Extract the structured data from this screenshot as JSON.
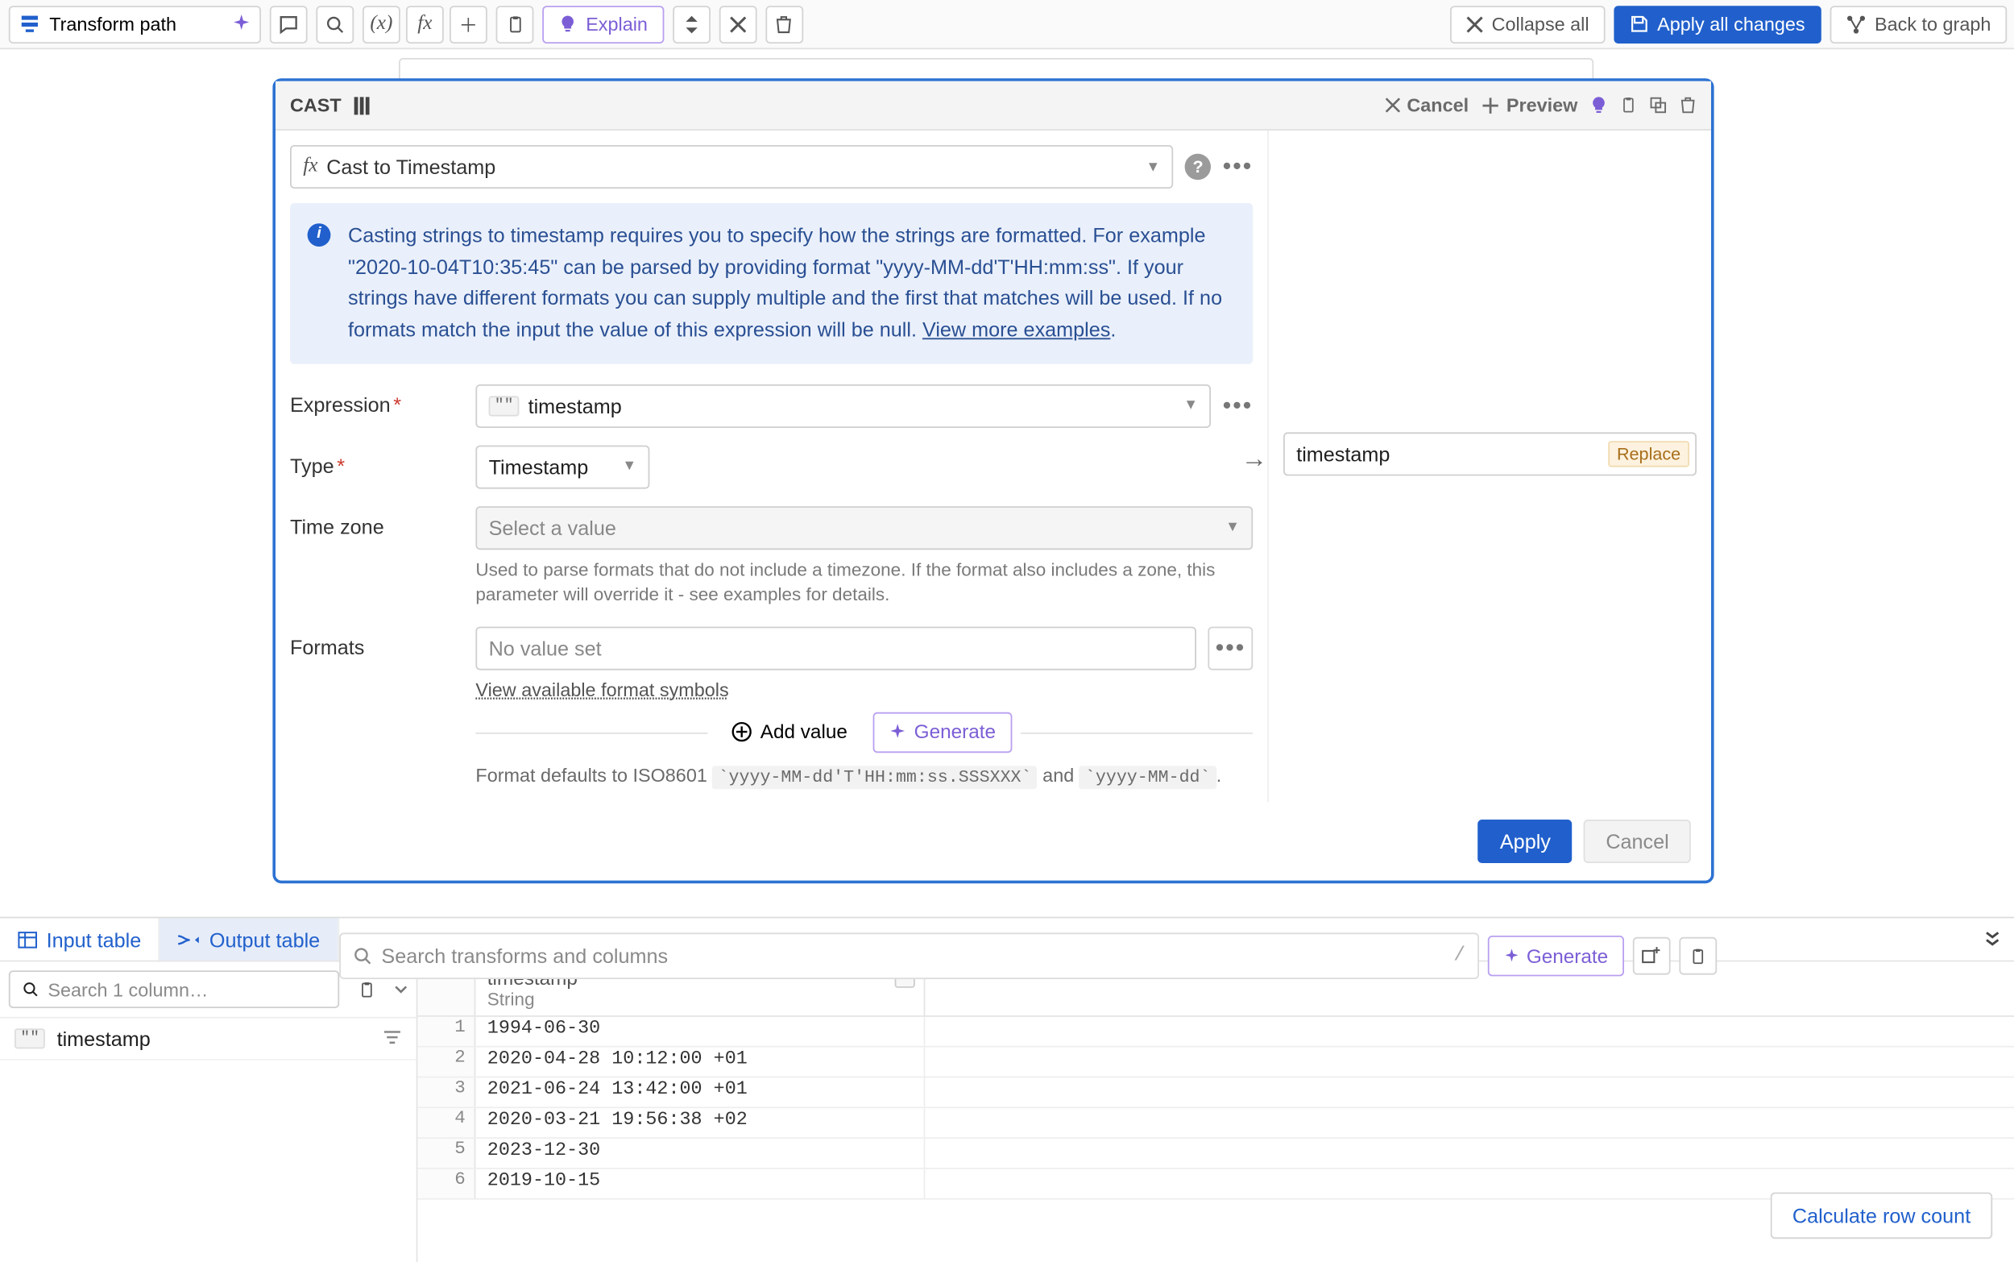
{
  "toolbar": {
    "transform_path": "Transform path",
    "explain": "Explain",
    "collapse_all": "Collapse all",
    "apply_all": "Apply all changes",
    "back_to_graph": "Back to graph"
  },
  "card": {
    "title": "CAST",
    "cancel": "Cancel",
    "preview": "Preview",
    "cast_select": "Cast to Timestamp",
    "info_text": "Casting strings to timestamp requires you to specify how the strings are formatted. For example \"2020-10-04T10:35:45\" can be parsed by providing format \"yyyy-MM-dd'T'HH:mm:ss\". If your strings have different formats you can supply multiple and the first that matches will be used. If no formats match the input the value of this expression will be null.",
    "info_link": "View more examples",
    "labels": {
      "expression": "Expression",
      "type": "Type",
      "timezone": "Time zone",
      "formats": "Formats"
    },
    "expression_value": "timestamp",
    "type_value": "Timestamp",
    "timezone_placeholder": "Select a value",
    "timezone_hint": "Used to parse formats that do not include a timezone. If the format also includes a zone, this parameter will override it - see examples for details.",
    "formats_placeholder": "No value set",
    "formats_symbols_link": "View available format symbols",
    "add_value": "Add value",
    "generate": "Generate",
    "format_default_pre": "Format defaults to ISO8601",
    "format_default_code1": "`yyyy-MM-dd'T'HH:mm:ss.SSSXXX`",
    "format_default_and": " and ",
    "format_default_code2": "`yyyy-MM-dd`",
    "format_default_post": ".",
    "apply": "Apply",
    "cancel_btn": "Cancel"
  },
  "output": {
    "field": "timestamp",
    "replace": "Replace"
  },
  "search": {
    "placeholder": "Search transforms and columns",
    "generate": "Generate"
  },
  "tabs": {
    "input": "Input table",
    "output": "Output table"
  },
  "columns": {
    "search_placeholder": "Search 1 column…",
    "list": [
      {
        "name": "timestamp"
      }
    ]
  },
  "table": {
    "header": {
      "name": "timestamp",
      "type": "String"
    },
    "rows": [
      {
        "n": "1",
        "v": "1994-06-30"
      },
      {
        "n": "2",
        "v": "2020-04-28 10:12:00 +01"
      },
      {
        "n": "3",
        "v": "2021-06-24 13:42:00 +01"
      },
      {
        "n": "4",
        "v": "2020-03-21 19:56:38 +02"
      },
      {
        "n": "5",
        "v": "2023-12-30"
      },
      {
        "n": "6",
        "v": "2019-10-15"
      }
    ]
  },
  "calculate_row_count": "Calculate row count"
}
